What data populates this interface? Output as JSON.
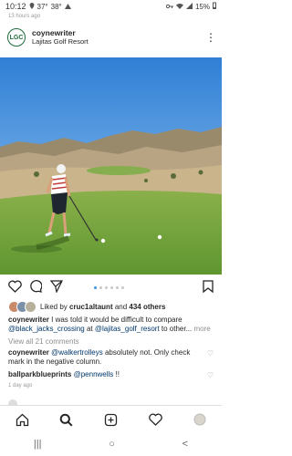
{
  "status_bar": {
    "time": "10:12",
    "temp1": "37°",
    "temp2": "38°",
    "battery": "15%",
    "icons": [
      "warning-icon",
      "wifi-icon",
      "signal-icon",
      "battery-icon",
      "key-icon",
      "location-icon"
    ]
  },
  "post_age_top": "13 hours ago",
  "header": {
    "logo_text": "LGC",
    "username": "coynewriter",
    "location": "Lajitas Golf Resort",
    "more_icon": "more-vertical-icon"
  },
  "carousel": {
    "total": 6,
    "active": 1
  },
  "actions": {
    "icons": [
      "heart-icon",
      "comment-icon",
      "send-icon",
      "bookmark-icon"
    ]
  },
  "likes": {
    "prefix": "Liked by ",
    "user": "cruc1altaunt",
    "middle": " and ",
    "count": "434 others"
  },
  "caption": {
    "user": "coynewriter",
    "text1": " I was told it would be difficult to compare ",
    "mention1": "@black_jacks_crossing",
    "text2": " at ",
    "mention2": "@lajitas_golf_resort",
    "text3": " to other...",
    "more": " more"
  },
  "view_all": "View all 21 comments",
  "comments": [
    {
      "user": "coynewriter",
      "mention": "@walkertrolleys",
      "text": " absolutely not. Only check mark in the negative column."
    },
    {
      "user": "ballparkblueprints",
      "mention": "@pennwells",
      "text": " !!"
    }
  ],
  "post_age_bottom": "1 day ago",
  "tabbar": [
    "home-icon",
    "search-icon",
    "add-icon",
    "activity-heart-icon",
    "profile-avatar-icon"
  ],
  "navbar": {
    "recents": "|||",
    "home": "○",
    "back": "<"
  },
  "colors": {
    "link": "#00376b",
    "muted": "#8e8e8e",
    "dot_active": "#3897f0"
  }
}
